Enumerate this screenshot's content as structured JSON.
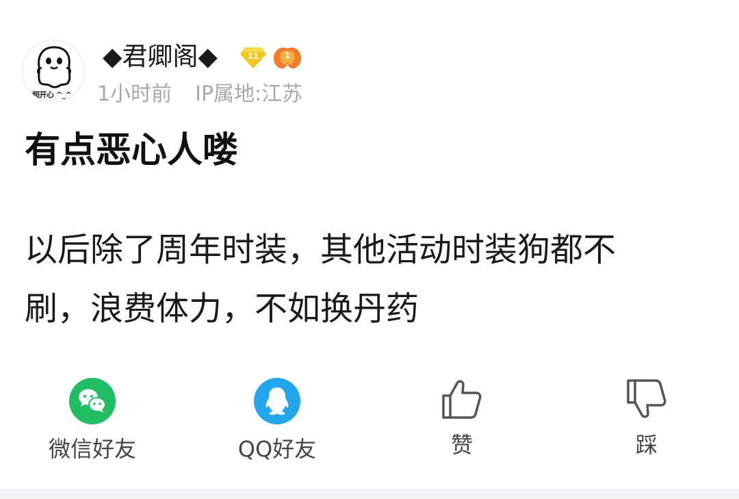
{
  "author": {
    "name": "◆君卿阁◆",
    "avatar_caption": "超开心 ^_^",
    "level": "11",
    "medal": "1"
  },
  "meta": {
    "time": "1小时前",
    "ip_location": "IP属地:江苏"
  },
  "post": {
    "title": "有点恶心人喽",
    "body_lines": [
      "以后除了周年时装，其他活动时装狗都不",
      "刷，浪费体力，不如换丹药"
    ]
  },
  "actions": {
    "wechat": "微信好友",
    "qq": "QQ好友",
    "like": "赞",
    "dislike": "踩"
  },
  "colors": {
    "wechat_green": "#1fbd64",
    "qq_blue": "#22a7ec",
    "level_gold": "#f5c51c",
    "medal_orange": "#f57b2c"
  }
}
